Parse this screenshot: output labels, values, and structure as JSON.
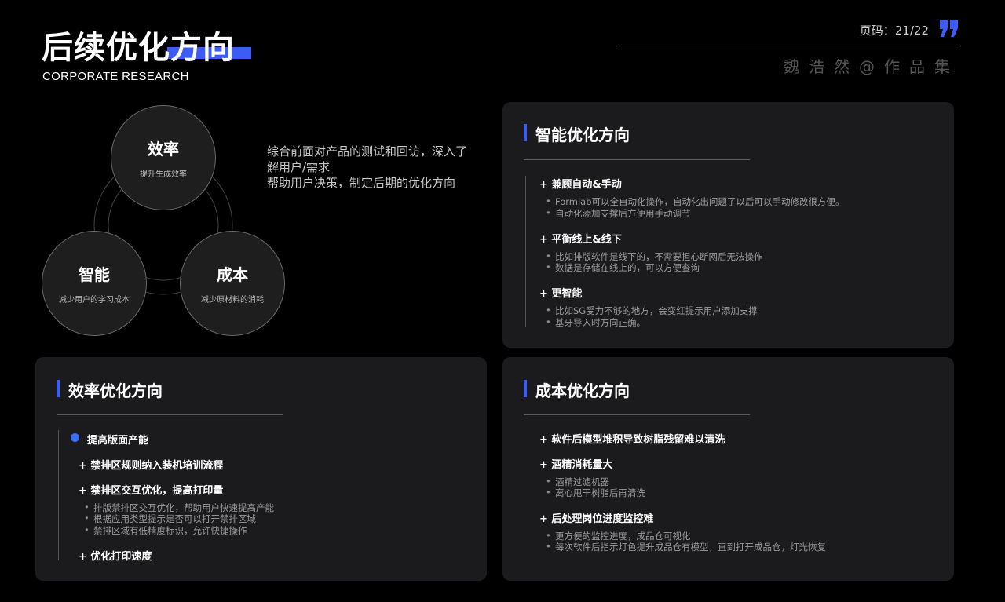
{
  "header": {
    "title": "后续优化方向",
    "subtitle": "CORPORATE RESEARCH",
    "page_label": "页码：21/22",
    "author": "魏浩然@作品集"
  },
  "diagram": {
    "efficiency": {
      "title": "效率",
      "sub": "提升生成效率"
    },
    "smart": {
      "title": "智能",
      "sub": "减少用户的学习成本"
    },
    "cost": {
      "title": "成本",
      "sub": "减少原材料的消耗"
    }
  },
  "intro": {
    "line1": "综合前面对产品的测试和回访，深入了解用户/需求",
    "line2": "帮助用户决策，制定后期的优化方向"
  },
  "smart_card": {
    "title": "智能优化方向",
    "sections": [
      {
        "heading": "+ 兼顾自动&手动",
        "bullets": [
          "Formlab可以全自动化操作，自动化出问题了以后可以手动修改很方便。",
          "自动化添加支撑后方便用手动调节"
        ]
      },
      {
        "heading": "+ 平衡线上&线下",
        "bullets": [
          "比如排版软件是线下的，不需要担心断网后无法操作",
          "数据是存储在线上的，可以方便查询"
        ]
      },
      {
        "heading": "+ 更智能",
        "bullets": [
          "比如SG受力不够的地方，会变红提示用户添加支撑",
          "基牙导入时方向正确。"
        ]
      }
    ]
  },
  "efficiency_card": {
    "title": "效率优化方向",
    "lead": "提高版面产能",
    "item1": "+ 禁排区规则纳入装机培训流程",
    "item2": "+ 禁排区交互优化，提高打印量",
    "bullets": [
      "排版禁排区交互优化，帮助用户快速提高产能",
      "根据应用类型提示是否可以打开禁排区域",
      "禁排区域有低精度标识，允许快捷操作"
    ],
    "item3": "+ 优化打印速度"
  },
  "cost_card": {
    "title": "成本优化方向",
    "item1": "+ 软件后模型堆积导致树脂残留难以清洗",
    "item2": "+ 酒精消耗量大",
    "bullets2": [
      "酒精过滤机器",
      "离心甩干树脂后再清洗"
    ],
    "item3": "+ 后处理岗位进度监控难",
    "bullets3": [
      "更方便的监控进度，成品仓可视化",
      "每次软件后指示灯色提升成品仓有模型，直到打开成品仓，灯光恢复"
    ]
  },
  "colors": {
    "accent": "#3d5cf5",
    "card_bg": "#1b1b1d",
    "page_bg": "#000000"
  }
}
